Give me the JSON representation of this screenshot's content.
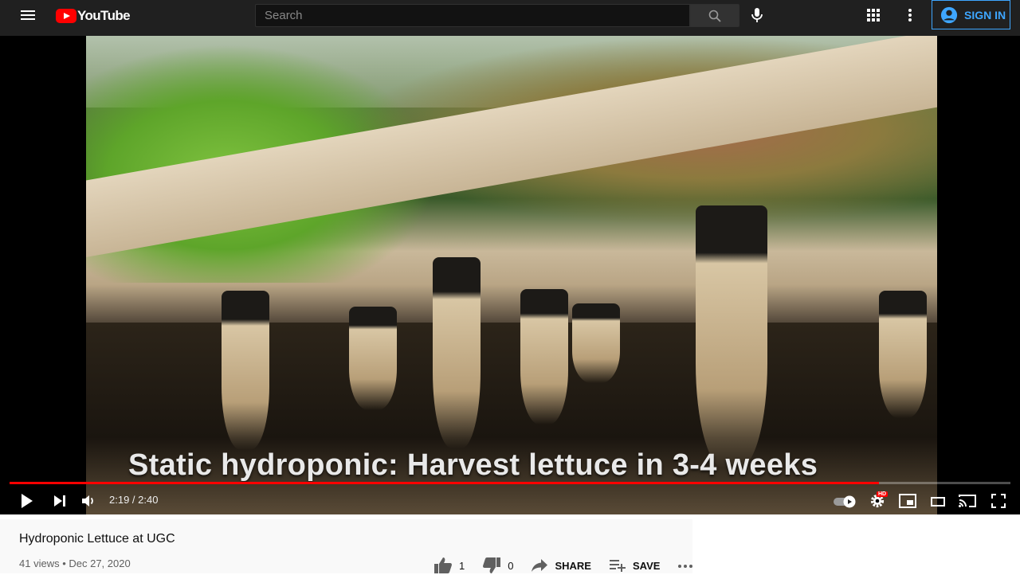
{
  "masthead": {
    "logo_text": "YouTube",
    "search_placeholder": "Search",
    "signin_label": "SIGN IN"
  },
  "player": {
    "caption": "Static hydroponic: Harvest lettuce in 3-4 weeks",
    "time_display": "2:19 / 2:40",
    "progress_fraction": 0.869,
    "hd_badge": "HD",
    "colors": {
      "progress": "#ff0000",
      "signin_accent": "#3ea6ff"
    }
  },
  "video_info": {
    "title": "Hydroponic Lettuce at UGC",
    "meta": "41 views • Dec 27, 2020",
    "like_count": "1",
    "dislike_count": "0",
    "share_label": "SHARE",
    "save_label": "SAVE"
  }
}
